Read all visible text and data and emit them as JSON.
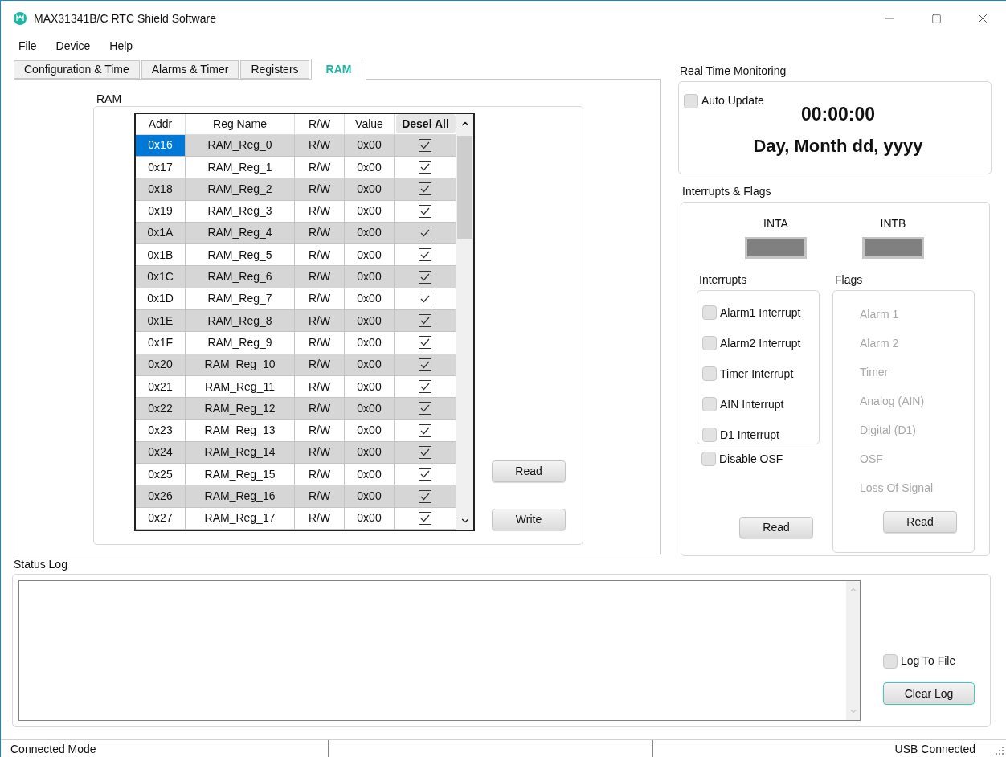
{
  "window": {
    "title": "MAX31341B/C RTC Shield Software"
  },
  "menu": [
    "File",
    "Device",
    "Help"
  ],
  "tabs": [
    {
      "label": "Configuration & Time",
      "selected": false
    },
    {
      "label": "Alarms & Timer",
      "selected": false
    },
    {
      "label": "Registers",
      "selected": false
    },
    {
      "label": "RAM",
      "selected": true
    }
  ],
  "ram": {
    "label": "RAM",
    "columns": [
      "Addr",
      "Reg Name",
      "R/W",
      "Value"
    ],
    "desel_all": "Desel All",
    "rows": [
      {
        "addr": "0x16",
        "name": "RAM_Reg_0",
        "access": "R/W",
        "value": "0x00",
        "checked": true,
        "selected": true
      },
      {
        "addr": "0x17",
        "name": "RAM_Reg_1",
        "access": "R/W",
        "value": "0x00",
        "checked": true,
        "selected": false
      },
      {
        "addr": "0x18",
        "name": "RAM_Reg_2",
        "access": "R/W",
        "value": "0x00",
        "checked": true,
        "selected": false
      },
      {
        "addr": "0x19",
        "name": "RAM_Reg_3",
        "access": "R/W",
        "value": "0x00",
        "checked": true,
        "selected": false
      },
      {
        "addr": "0x1A",
        "name": "RAM_Reg_4",
        "access": "R/W",
        "value": "0x00",
        "checked": true,
        "selected": false
      },
      {
        "addr": "0x1B",
        "name": "RAM_Reg_5",
        "access": "R/W",
        "value": "0x00",
        "checked": true,
        "selected": false
      },
      {
        "addr": "0x1C",
        "name": "RAM_Reg_6",
        "access": "R/W",
        "value": "0x00",
        "checked": true,
        "selected": false
      },
      {
        "addr": "0x1D",
        "name": "RAM_Reg_7",
        "access": "R/W",
        "value": "0x00",
        "checked": true,
        "selected": false
      },
      {
        "addr": "0x1E",
        "name": "RAM_Reg_8",
        "access": "R/W",
        "value": "0x00",
        "checked": true,
        "selected": false
      },
      {
        "addr": "0x1F",
        "name": "RAM_Reg_9",
        "access": "R/W",
        "value": "0x00",
        "checked": true,
        "selected": false
      },
      {
        "addr": "0x20",
        "name": "RAM_Reg_10",
        "access": "R/W",
        "value": "0x00",
        "checked": true,
        "selected": false
      },
      {
        "addr": "0x21",
        "name": "RAM_Reg_11",
        "access": "R/W",
        "value": "0x00",
        "checked": true,
        "selected": false
      },
      {
        "addr": "0x22",
        "name": "RAM_Reg_12",
        "access": "R/W",
        "value": "0x00",
        "checked": true,
        "selected": false
      },
      {
        "addr": "0x23",
        "name": "RAM_Reg_13",
        "access": "R/W",
        "value": "0x00",
        "checked": true,
        "selected": false
      },
      {
        "addr": "0x24",
        "name": "RAM_Reg_14",
        "access": "R/W",
        "value": "0x00",
        "checked": true,
        "selected": false
      },
      {
        "addr": "0x25",
        "name": "RAM_Reg_15",
        "access": "R/W",
        "value": "0x00",
        "checked": true,
        "selected": false
      },
      {
        "addr": "0x26",
        "name": "RAM_Reg_16",
        "access": "R/W",
        "value": "0x00",
        "checked": true,
        "selected": false
      },
      {
        "addr": "0x27",
        "name": "RAM_Reg_17",
        "access": "R/W",
        "value": "0x00",
        "checked": true,
        "selected": false
      }
    ],
    "buttons": [
      "Read",
      "Write"
    ]
  },
  "monitoring": {
    "label": "Real Time Monitoring",
    "auto_update": {
      "label": "Auto Update",
      "checked": false
    },
    "time": "00:00:00",
    "date": "Day, Month dd, yyyy"
  },
  "interrupts_flags": {
    "label": "Interrupts & Flags",
    "indicators": [
      "INTA",
      "INTB"
    ],
    "interrupts": {
      "label": "Interrupts",
      "items": [
        {
          "label": "Alarm1 Interrupt",
          "checked": false
        },
        {
          "label": "Alarm2 Interrupt",
          "checked": false
        },
        {
          "label": "Timer Interrupt",
          "checked": false
        },
        {
          "label": "AIN Interrupt",
          "checked": false
        },
        {
          "label": "D1 Interrupt",
          "checked": false
        }
      ]
    },
    "disable_osf": {
      "label": "Disable OSF",
      "checked": false
    },
    "interrupts_read": "Read",
    "flags": {
      "label": "Flags",
      "items": [
        {
          "label": "Alarm 1",
          "disabled": true
        },
        {
          "label": "Alarm 2",
          "disabled": true
        },
        {
          "label": "Timer",
          "disabled": true
        },
        {
          "label": "Analog (AIN)",
          "disabled": true
        },
        {
          "label": "Digital (D1)",
          "disabled": true
        },
        {
          "label": "OSF",
          "disabled": true
        },
        {
          "label": "Loss Of Signal",
          "disabled": true
        }
      ]
    },
    "flags_read": "Read"
  },
  "status_log": {
    "label": "Status Log",
    "log_to_file": {
      "label": "Log To File",
      "checked": false
    },
    "clear": "Clear Log"
  },
  "status_bar": {
    "left": "Connected Mode",
    "right": "USB Connected"
  }
}
